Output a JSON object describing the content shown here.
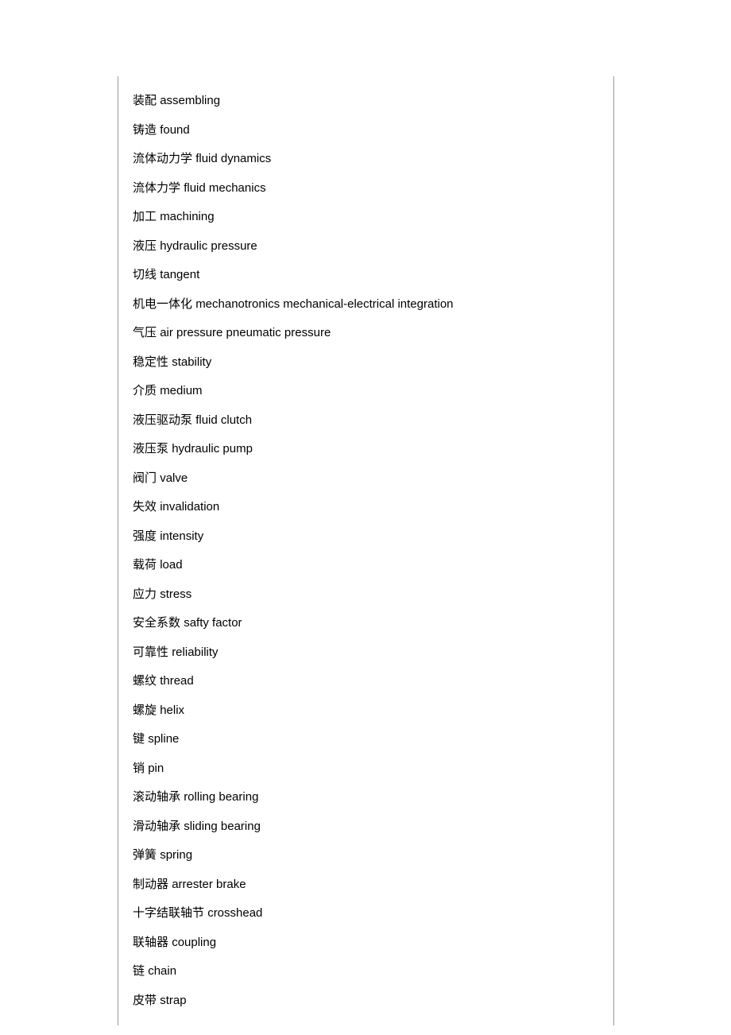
{
  "terms": [
    {
      "cn": "装配",
      "en": "assembling"
    },
    {
      "cn": "铸造",
      "en": "found"
    },
    {
      "cn": "流体动力学",
      "en": "fluid dynamics"
    },
    {
      "cn": "流体力学",
      "en": "fluid mechanics"
    },
    {
      "cn": "加工",
      "en": "machining"
    },
    {
      "cn": "液压",
      "en": "hydraulic pressure"
    },
    {
      "cn": "切线",
      "en": "tangent"
    },
    {
      "cn": "机电一体化",
      "en": "mechanotronics mechanical-electrical integration"
    },
    {
      "cn": "气压",
      "en": "air pressure pneumatic pressure"
    },
    {
      "cn": "稳定性",
      "en": "stability"
    },
    {
      "cn": "介质",
      "en": "medium"
    },
    {
      "cn": "液压驱动泵",
      "en": "fluid clutch"
    },
    {
      "cn": "液压泵",
      "en": "hydraulic pump"
    },
    {
      "cn": "阀门",
      "en": "valve"
    },
    {
      "cn": "失效",
      "en": "invalidation"
    },
    {
      "cn": "强度",
      "en": "intensity"
    },
    {
      "cn": "载荷",
      "en": "load"
    },
    {
      "cn": "应力",
      "en": "stress"
    },
    {
      "cn": "安全系数",
      "en": "safty factor"
    },
    {
      "cn": "可靠性",
      "en": "reliability"
    },
    {
      "cn": "螺纹",
      "en": "thread"
    },
    {
      "cn": "螺旋",
      "en": "helix"
    },
    {
      "cn": "键",
      "en": "spline"
    },
    {
      "cn": "销",
      "en": "pin"
    },
    {
      "cn": "滚动轴承",
      "en": "rolling bearing"
    },
    {
      "cn": "滑动轴承",
      "en": "sliding bearing"
    },
    {
      "cn": "弹簧",
      "en": "spring"
    },
    {
      "cn": "制动器",
      "en": "arrester brake"
    },
    {
      "cn": "十字结联轴节",
      "en": "crosshead"
    },
    {
      "cn": "联轴器",
      "en": "coupling"
    },
    {
      "cn": "链",
      "en": "chain"
    },
    {
      "cn": "皮带",
      "en": "strap"
    }
  ]
}
